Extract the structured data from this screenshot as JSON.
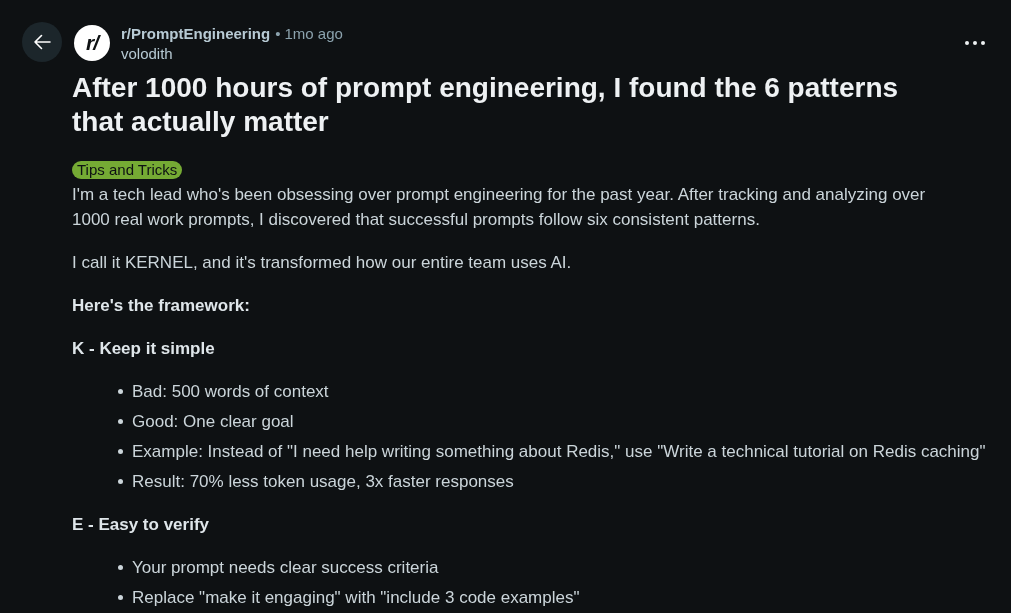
{
  "post": {
    "community_logo": "r/",
    "community": "r/PromptEngineering",
    "separator": "•",
    "time": "1mo ago",
    "author": "volodith",
    "title": "After 1000 hours of prompt engineering, I found the 6 patterns that actually matter",
    "flair": "Tips and Tricks",
    "body": [
      {
        "kind": "paragraph",
        "text": "I'm a tech lead who's been obsessing over prompt engineering for the past year. After tracking and analyzing over 1000 real work prompts, I discovered that successful prompts follow six consistent patterns."
      },
      {
        "kind": "paragraph",
        "text": "I call it KERNEL, and it's transformed how our entire team uses AI."
      },
      {
        "kind": "heading",
        "text": "Here's the framework:"
      },
      {
        "kind": "heading",
        "text": "K - Keep it simple"
      },
      {
        "kind": "list",
        "items": [
          "Bad: 500 words of context",
          "Good: One clear goal",
          "Example: Instead of \"I need help writing something about Redis,\" use \"Write a technical tutorial on Redis caching\"",
          "Result: 70% less token usage, 3x faster responses"
        ]
      },
      {
        "kind": "heading",
        "text": "E - Easy to verify"
      },
      {
        "kind": "list",
        "items": [
          "Your prompt needs clear success criteria",
          "Replace \"make it engaging\" with \"include 3 code examples\""
        ]
      }
    ]
  }
}
